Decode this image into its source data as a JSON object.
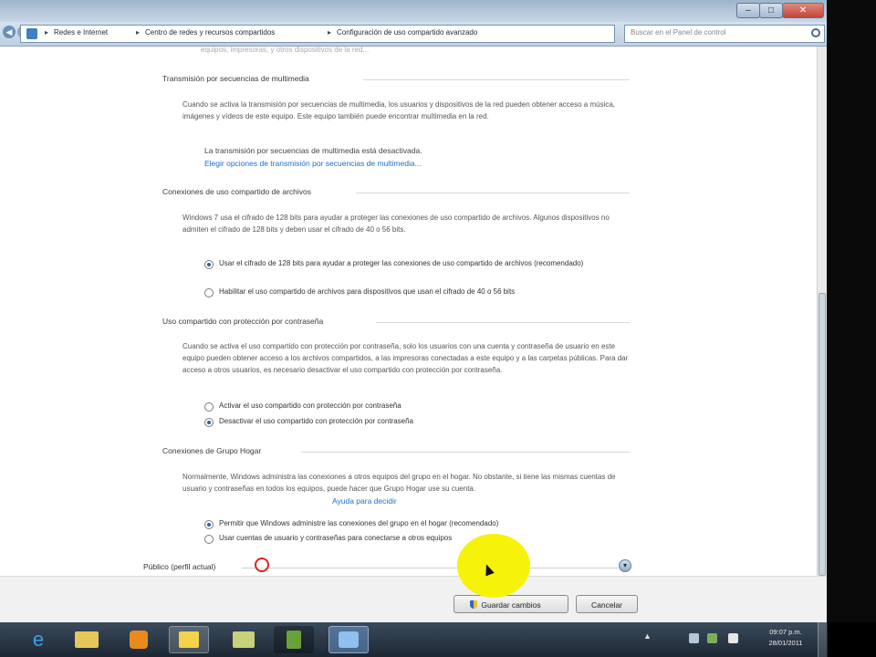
{
  "window": {
    "controls": {
      "minimize": "–",
      "maximize": "□",
      "close": "✕"
    }
  },
  "address_bar": {
    "icon": "network-center-icon",
    "breadcrumbs": [
      "Redes e Internet",
      "Centro de redes y recursos compartidos",
      "Configuración de uso compartido avanzado"
    ],
    "separator": "▸",
    "refresh_icon": "↻",
    "search_placeholder": "Buscar en el Panel de control"
  },
  "content": {
    "cut_off_line": "equipos, impresoras, y otros dispositivos de la red...",
    "sections": [
      {
        "title": "Transmisión por secuencias de multimedia",
        "text": "Cuando se activa la transmisión por secuencias de multimedia, los usuarios y dispositivos de la red pueden obtener acceso a música, imágenes y vídeos de este equipo. Este equipo también puede encontrar multimedia en la red.",
        "status": "La transmisión por secuencias de multimedia está desactivada.",
        "link": "Elegir opciones de transmisión por secuencias de multimedia..."
      },
      {
        "title": "Conexiones de uso compartido de archivos",
        "text": "Windows 7 usa el cifrado de 128 bits para ayudar a proteger las conexiones de uso compartido de archivos. Algunos dispositivos no admiten el cifrado de 128 bits y deben usar el cifrado de 40 o 56 bits.",
        "options": [
          {
            "label": "Usar el cifrado de 128 bits para ayudar a proteger las conexiones de uso compartido de archivos (recomendado)",
            "selected": true
          },
          {
            "label": "Habilitar el uso compartido de archivos para dispositivos que usan el cifrado de 40 o 56 bits",
            "selected": false
          }
        ]
      },
      {
        "title": "Uso compartido con protección por contraseña",
        "text": "Cuando se activa el uso compartido con protección por contraseña, solo los usuarios con una cuenta y contraseña de usuario en este equipo pueden obtener acceso a los archivos compartidos, a las impresoras conectadas a este equipo y a las carpetas públicas. Para dar acceso a otros usuarios, es necesario desactivar el uso compartido con protección por contraseña.",
        "options": [
          {
            "label": "Activar el uso compartido con protección por contraseña",
            "selected": false
          },
          {
            "label": "Desactivar el uso compartido con protección por contraseña",
            "selected": true
          }
        ]
      },
      {
        "title": "Conexiones de Grupo Hogar",
        "text": "Normalmente, Windows administra las conexiones a otros equipos del grupo en el hogar. No obstante, si tiene las mismas cuentas de usuario y contraseñas en todos los equipos, puede hacer que Grupo Hogar use su cuenta.",
        "help_link": "Ayuda para decidir",
        "options": [
          {
            "label": "Permitir que Windows administre las conexiones del grupo en el hogar (recomendado)",
            "selected": true
          },
          {
            "label": "Usar cuentas de usuario y contraseñas para conectarse a otros equipos",
            "selected": false
          }
        ]
      }
    ],
    "profile_label": "Público (perfil actual)",
    "profile_toggle_icon": "▾"
  },
  "buttons": {
    "save": "Guardar cambios",
    "cancel": "Cancelar"
  },
  "taskbar": {
    "ie_glyph": "e",
    "tray_arrow": "▲",
    "clock_time": "09:07 p.m.",
    "clock_date": "28/01/2011"
  }
}
